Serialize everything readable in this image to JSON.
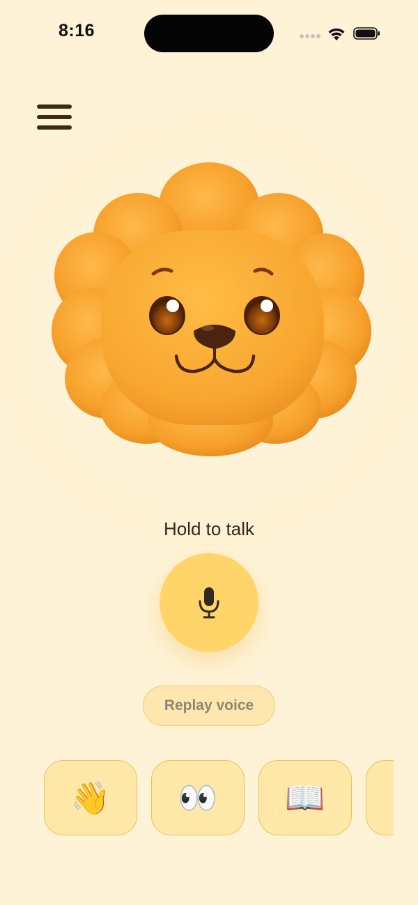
{
  "status_bar": {
    "time": "8:16"
  },
  "menu": {
    "icon": "hamburger-menu-icon"
  },
  "mascot": {
    "icon": "lion-character-icon"
  },
  "voice": {
    "hold_label": "Hold to talk",
    "mic_icon": "microphone-icon",
    "replay_label": "Replay voice"
  },
  "shortcuts": [
    {
      "icon": "waving-hand-icon",
      "glyph": "👋"
    },
    {
      "icon": "eyes-icon",
      "glyph": "👀"
    },
    {
      "icon": "open-book-icon",
      "glyph": "📖"
    },
    {
      "icon": "",
      "glyph": ""
    }
  ],
  "colors": {
    "background": "#FEF3D6",
    "mic_button": "#FFD56A",
    "shortcut_bg": "#FFE8A8",
    "shortcut_border": "#E9BF63",
    "text_dark": "#2f2a22",
    "menu_icon": "#3E2A14"
  }
}
